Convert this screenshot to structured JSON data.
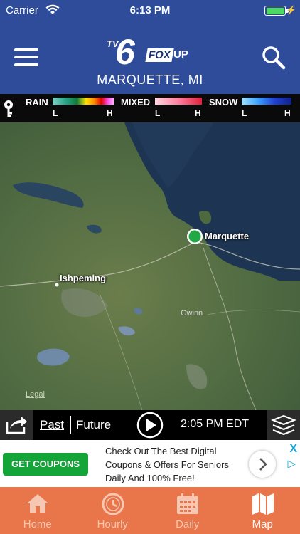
{
  "status_bar": {
    "carrier": "Carrier",
    "time": "6:13 PM"
  },
  "header": {
    "logo": {
      "tv": "TV",
      "six": "6",
      "fox": "FOX",
      "up": "UP"
    },
    "location": "MARQUETTE, MI"
  },
  "legend": {
    "groups": [
      {
        "label": "RAIN",
        "low": "L",
        "high": "H"
      },
      {
        "label": "MIXED",
        "low": "L",
        "high": "H"
      },
      {
        "label": "SNOW",
        "low": "L",
        "high": "H"
      }
    ]
  },
  "map": {
    "cities": [
      {
        "name": "Marquette"
      },
      {
        "name": "Ishpeming"
      }
    ],
    "legal": "Legal",
    "extra_label": "Gwinn"
  },
  "playback": {
    "past": "Past",
    "future": "Future",
    "time": "2:05 PM EDT"
  },
  "ad": {
    "button": "GET COUPONS",
    "text": "Check Out The Best Digital Coupons & Offers For Seniors Daily And 100% Free!",
    "close": "X"
  },
  "tabs": [
    {
      "label": "Home",
      "icon": "home-icon",
      "active": false
    },
    {
      "label": "Hourly",
      "icon": "clock-icon",
      "active": false
    },
    {
      "label": "Daily",
      "icon": "calendar-icon",
      "active": false
    },
    {
      "label": "Map",
      "icon": "map-icon",
      "active": true
    }
  ],
  "colors": {
    "header": "#2e4c9a",
    "tabbar": "#e8764a",
    "location_marker": "#22a845",
    "ad_button": "#13a538"
  }
}
